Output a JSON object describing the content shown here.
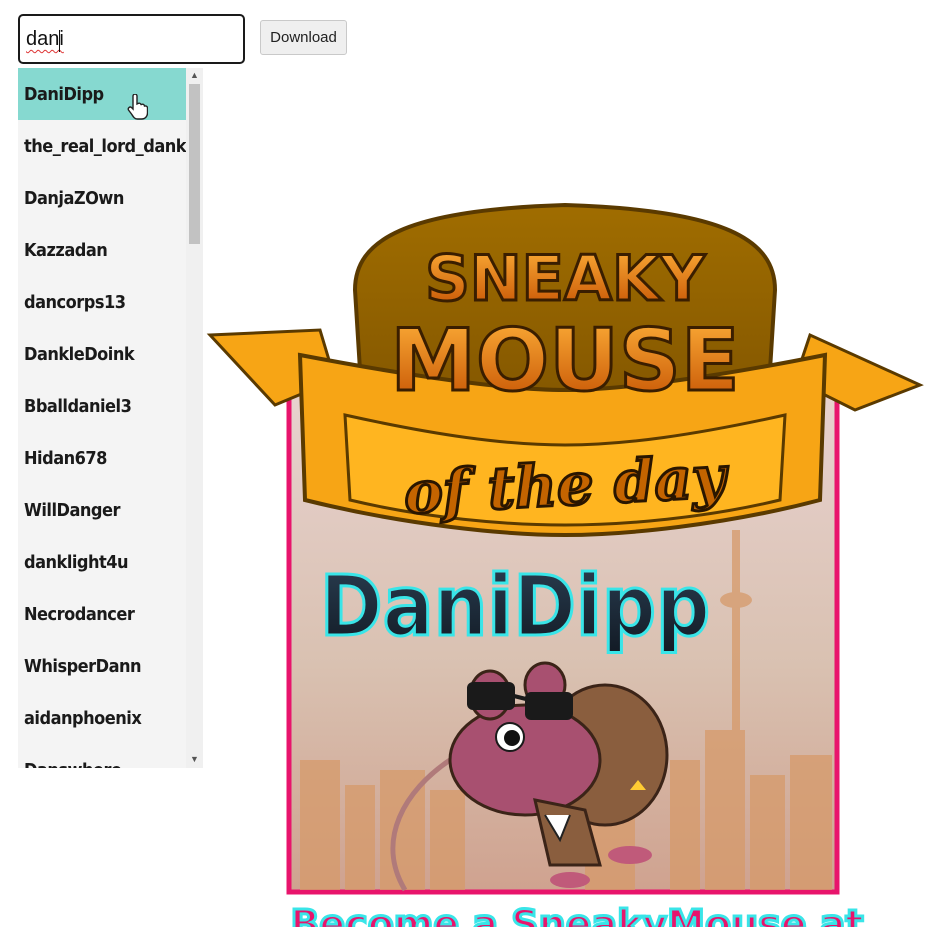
{
  "search": {
    "value": "dani"
  },
  "download_button": {
    "label": "Download"
  },
  "suggestions": [
    "DaniDipp",
    "the_real_lord_dankey",
    "DanjaZOwn",
    "Kazzadan",
    "dancorps13",
    "DankleDoink",
    "Bballdaniel3",
    "Hidan678",
    "WillDanger",
    "danklight4u",
    "Necrodancer",
    "WhisperDann",
    "aidanphoenix",
    "Danswhere"
  ],
  "active_suggestion_index": 0,
  "poster": {
    "title_line1": "SNEAKY",
    "title_line2": "MOUSE",
    "banner_text": "of the day",
    "winner_name": "DaniDipp",
    "footer_text": "Become a SneakyMouse at"
  },
  "colors": {
    "highlight": "#86d9d0",
    "poster_border": "#e8146c",
    "banner": "#f7a515",
    "name_glow": "#39e5e8"
  }
}
